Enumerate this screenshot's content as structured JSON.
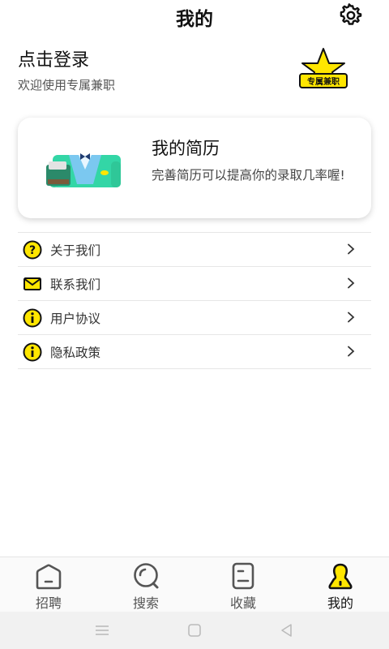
{
  "header": {
    "title": "我的"
  },
  "login": {
    "title": "点击登录",
    "subtitle": "欢迎使用专属兼职",
    "badge_text": "专属兼职"
  },
  "resume": {
    "title": "我的简历",
    "description": "完善简历可以提高你的录取几率喔!"
  },
  "menu": {
    "items": [
      {
        "label": "关于我们",
        "icon": "question-icon"
      },
      {
        "label": "联系我们",
        "icon": "mail-icon"
      },
      {
        "label": "用户协议",
        "icon": "info-icon"
      },
      {
        "label": "隐私政策",
        "icon": "info-icon"
      }
    ]
  },
  "nav": {
    "items": [
      {
        "label": "招聘",
        "icon": "home-icon"
      },
      {
        "label": "搜索",
        "icon": "search-icon"
      },
      {
        "label": "收藏",
        "icon": "document-icon"
      },
      {
        "label": "我的",
        "icon": "user-icon",
        "active": true
      }
    ]
  },
  "colors": {
    "accent": "#ffe600",
    "outline": "#111111",
    "nav_icon": "#555555"
  }
}
